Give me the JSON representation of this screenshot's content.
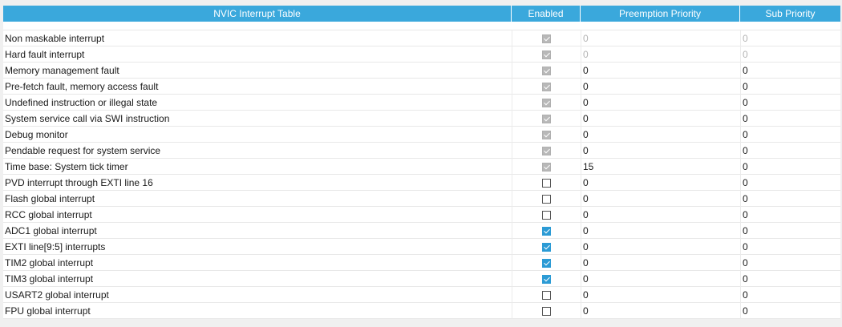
{
  "table": {
    "headers": {
      "name": "NVIC Interrupt Table",
      "enabled": "Enabled",
      "preemption": "Preemption Priority",
      "sub": "Sub Priority"
    },
    "rows": [
      {
        "name": "Non maskable interrupt",
        "enabled": true,
        "locked": true,
        "preemption": "0",
        "sub": "0",
        "dim": true
      },
      {
        "name": "Hard fault interrupt",
        "enabled": true,
        "locked": true,
        "preemption": "0",
        "sub": "0",
        "dim": true
      },
      {
        "name": "Memory management fault",
        "enabled": true,
        "locked": true,
        "preemption": "0",
        "sub": "0",
        "dim": false
      },
      {
        "name": "Pre-fetch fault, memory access fault",
        "enabled": true,
        "locked": true,
        "preemption": "0",
        "sub": "0",
        "dim": false
      },
      {
        "name": "Undefined instruction or illegal state",
        "enabled": true,
        "locked": true,
        "preemption": "0",
        "sub": "0",
        "dim": false
      },
      {
        "name": "System service call via SWI instruction",
        "enabled": true,
        "locked": true,
        "preemption": "0",
        "sub": "0",
        "dim": false
      },
      {
        "name": "Debug monitor",
        "enabled": true,
        "locked": true,
        "preemption": "0",
        "sub": "0",
        "dim": false
      },
      {
        "name": "Pendable request for system service",
        "enabled": true,
        "locked": true,
        "preemption": "0",
        "sub": "0",
        "dim": false
      },
      {
        "name": "Time base: System tick timer",
        "enabled": true,
        "locked": true,
        "preemption": "15",
        "sub": "0",
        "dim": false
      },
      {
        "name": "PVD interrupt through EXTI line 16",
        "enabled": false,
        "locked": false,
        "preemption": "0",
        "sub": "0",
        "dim": false
      },
      {
        "name": "Flash global interrupt",
        "enabled": false,
        "locked": false,
        "preemption": "0",
        "sub": "0",
        "dim": false
      },
      {
        "name": "RCC global interrupt",
        "enabled": false,
        "locked": false,
        "preemption": "0",
        "sub": "0",
        "dim": false
      },
      {
        "name": "ADC1 global interrupt",
        "enabled": true,
        "locked": false,
        "preemption": "0",
        "sub": "0",
        "dim": false
      },
      {
        "name": "EXTI line[9:5] interrupts",
        "enabled": true,
        "locked": false,
        "preemption": "0",
        "sub": "0",
        "dim": false
      },
      {
        "name": "TIM2 global interrupt",
        "enabled": true,
        "locked": false,
        "preemption": "0",
        "sub": "0",
        "dim": false
      },
      {
        "name": "TIM3 global interrupt",
        "enabled": true,
        "locked": false,
        "preemption": "0",
        "sub": "0",
        "dim": false
      },
      {
        "name": "USART2 global interrupt",
        "enabled": false,
        "locked": false,
        "preemption": "0",
        "sub": "0",
        "dim": false
      },
      {
        "name": "FPU global interrupt",
        "enabled": false,
        "locked": false,
        "preemption": "0",
        "sub": "0",
        "dim": false
      }
    ]
  },
  "colors": {
    "header_bg": "#3aa8dc",
    "checkbox_checked": "#2c9bd5",
    "checkbox_locked": "#b8b8b8"
  }
}
